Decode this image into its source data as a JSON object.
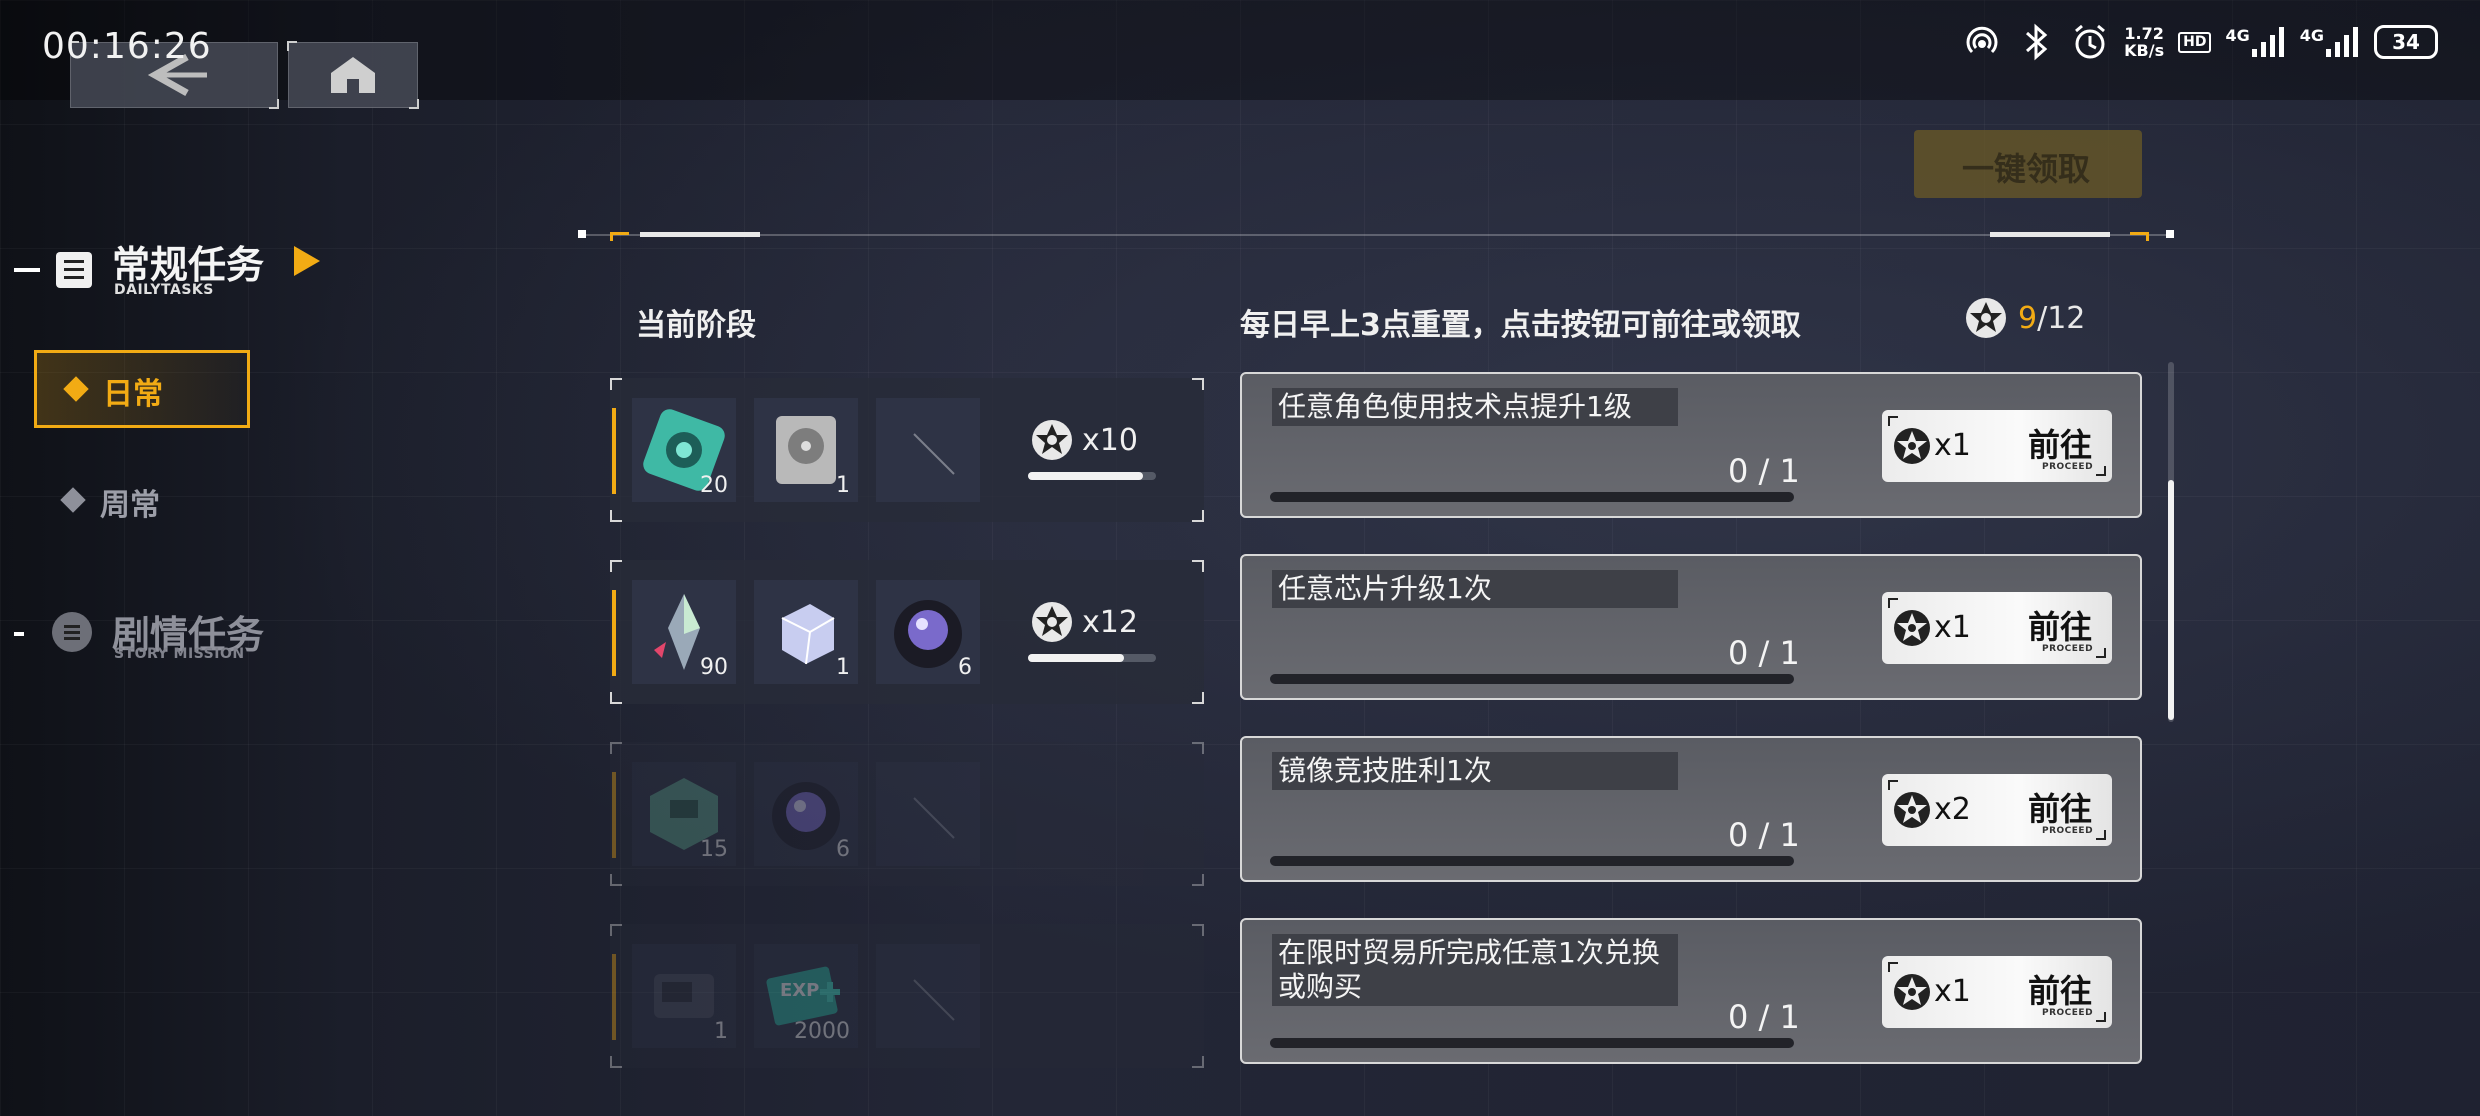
{
  "status_bar": {
    "time": "00:16:26",
    "net_speed_value": "1.72",
    "net_speed_unit": "KB/s",
    "hd_label": "HD",
    "signal1_label": "4G",
    "signal2_label": "4G",
    "battery": "34"
  },
  "sidebar": {
    "daily_tasks": {
      "title": "常规任务",
      "subtitle": "DAILYTASKS"
    },
    "tabs": [
      {
        "label": "日常",
        "active": true
      },
      {
        "label": "周常",
        "active": false
      }
    ],
    "story_mission": {
      "title": "剧情任务",
      "subtitle": "STORY MISSION"
    }
  },
  "claim_all_label": "一键领取",
  "stage_header": "当前阶段",
  "tasks_header": "每日早上3点重置，点击按钮可前往或领取",
  "points": {
    "current": "9",
    "total": "/12"
  },
  "stage_rewards": [
    {
      "items": [
        {
          "icon": "gear-chip",
          "count": "20"
        },
        {
          "icon": "hard-drive",
          "count": "1"
        },
        {
          "icon": "empty-slot",
          "count": ""
        }
      ],
      "points": "x10",
      "progress": 0.9,
      "state": "active"
    },
    {
      "items": [
        {
          "icon": "crystal-shard",
          "count": "90"
        },
        {
          "icon": "ice-cube",
          "count": "1"
        },
        {
          "icon": "lens",
          "count": "6"
        }
      ],
      "points": "x12",
      "progress": 0.75,
      "state": "active"
    },
    {
      "items": [
        {
          "icon": "hex-module",
          "count": "15"
        },
        {
          "icon": "lens",
          "count": "6"
        },
        {
          "icon": "empty-slot",
          "count": ""
        }
      ],
      "points": "",
      "progress": 0,
      "state": "locked"
    },
    {
      "items": [
        {
          "icon": "machine-part",
          "count": "1"
        },
        {
          "icon": "exp-card",
          "count": "2000"
        },
        {
          "icon": "empty-slot",
          "count": ""
        }
      ],
      "points": "",
      "progress": 0,
      "state": "locked"
    }
  ],
  "tasks": [
    {
      "name": "任意角色使用技术点提升1级",
      "progress": "0 / 1",
      "reward": "x1",
      "button": "前往",
      "button_sub": "PROCEED"
    },
    {
      "name": "任意芯片升级1次",
      "progress": "0 / 1",
      "reward": "x1",
      "button": "前往",
      "button_sub": "PROCEED"
    },
    {
      "name": "镜像竞技胜利1次",
      "progress": "0 / 1",
      "reward": "x2",
      "button": "前往",
      "button_sub": "PROCEED"
    },
    {
      "name": "在限时贸易所完成任意1次兑换或购买",
      "progress": "0 / 1",
      "reward": "x1",
      "button": "前往",
      "button_sub": "PROCEED"
    }
  ],
  "colors": {
    "accent": "#f2ab14",
    "bg": "#1f2231",
    "card": "#62646b"
  },
  "icons": {
    "back": "back-arrow-icon",
    "home": "home-icon",
    "points": "star-emblem-icon"
  }
}
